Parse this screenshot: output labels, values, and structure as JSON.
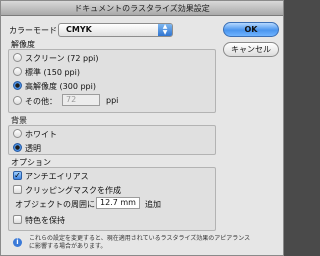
{
  "window": {
    "title": "ドキュメントのラスタライズ効果設定"
  },
  "color_model": {
    "label": "カラーモード：",
    "value": "CMYK"
  },
  "buttons": {
    "ok": "OK",
    "cancel": "キャンセル"
  },
  "resolution": {
    "title": "解像度",
    "options": [
      {
        "label": "スクリーン (72 ppi)",
        "selected": false
      },
      {
        "label": "標準 (150 ppi)",
        "selected": false
      },
      {
        "label": "高解像度 (300 ppi)",
        "selected": true
      },
      {
        "label": "その他：",
        "selected": false
      }
    ],
    "other_value": "72",
    "other_unit": "ppi"
  },
  "background": {
    "title": "背景",
    "options": [
      {
        "label": "ホワイト",
        "selected": false
      },
      {
        "label": "透明",
        "selected": true
      }
    ]
  },
  "options": {
    "title": "オプション",
    "antialias": {
      "label": "アンチエイリアス",
      "checked": true
    },
    "clipping_mask": {
      "label": "クリッピングマスクを作成",
      "checked": false
    },
    "padding": {
      "label": "オブジェクトの周囲に",
      "value": "12.7 mm",
      "suffix": "追加"
    },
    "preserve_spot": {
      "label": "特色を保持",
      "checked": false
    }
  },
  "info_note": "これらの設定を変更すると、現在適用されているラスタライズ効果のアピアランスに影響する場合があります。",
  "icons": {
    "dropdown": "chevron-updown-icon",
    "info": "info-icon",
    "check": "checkmark-icon"
  }
}
